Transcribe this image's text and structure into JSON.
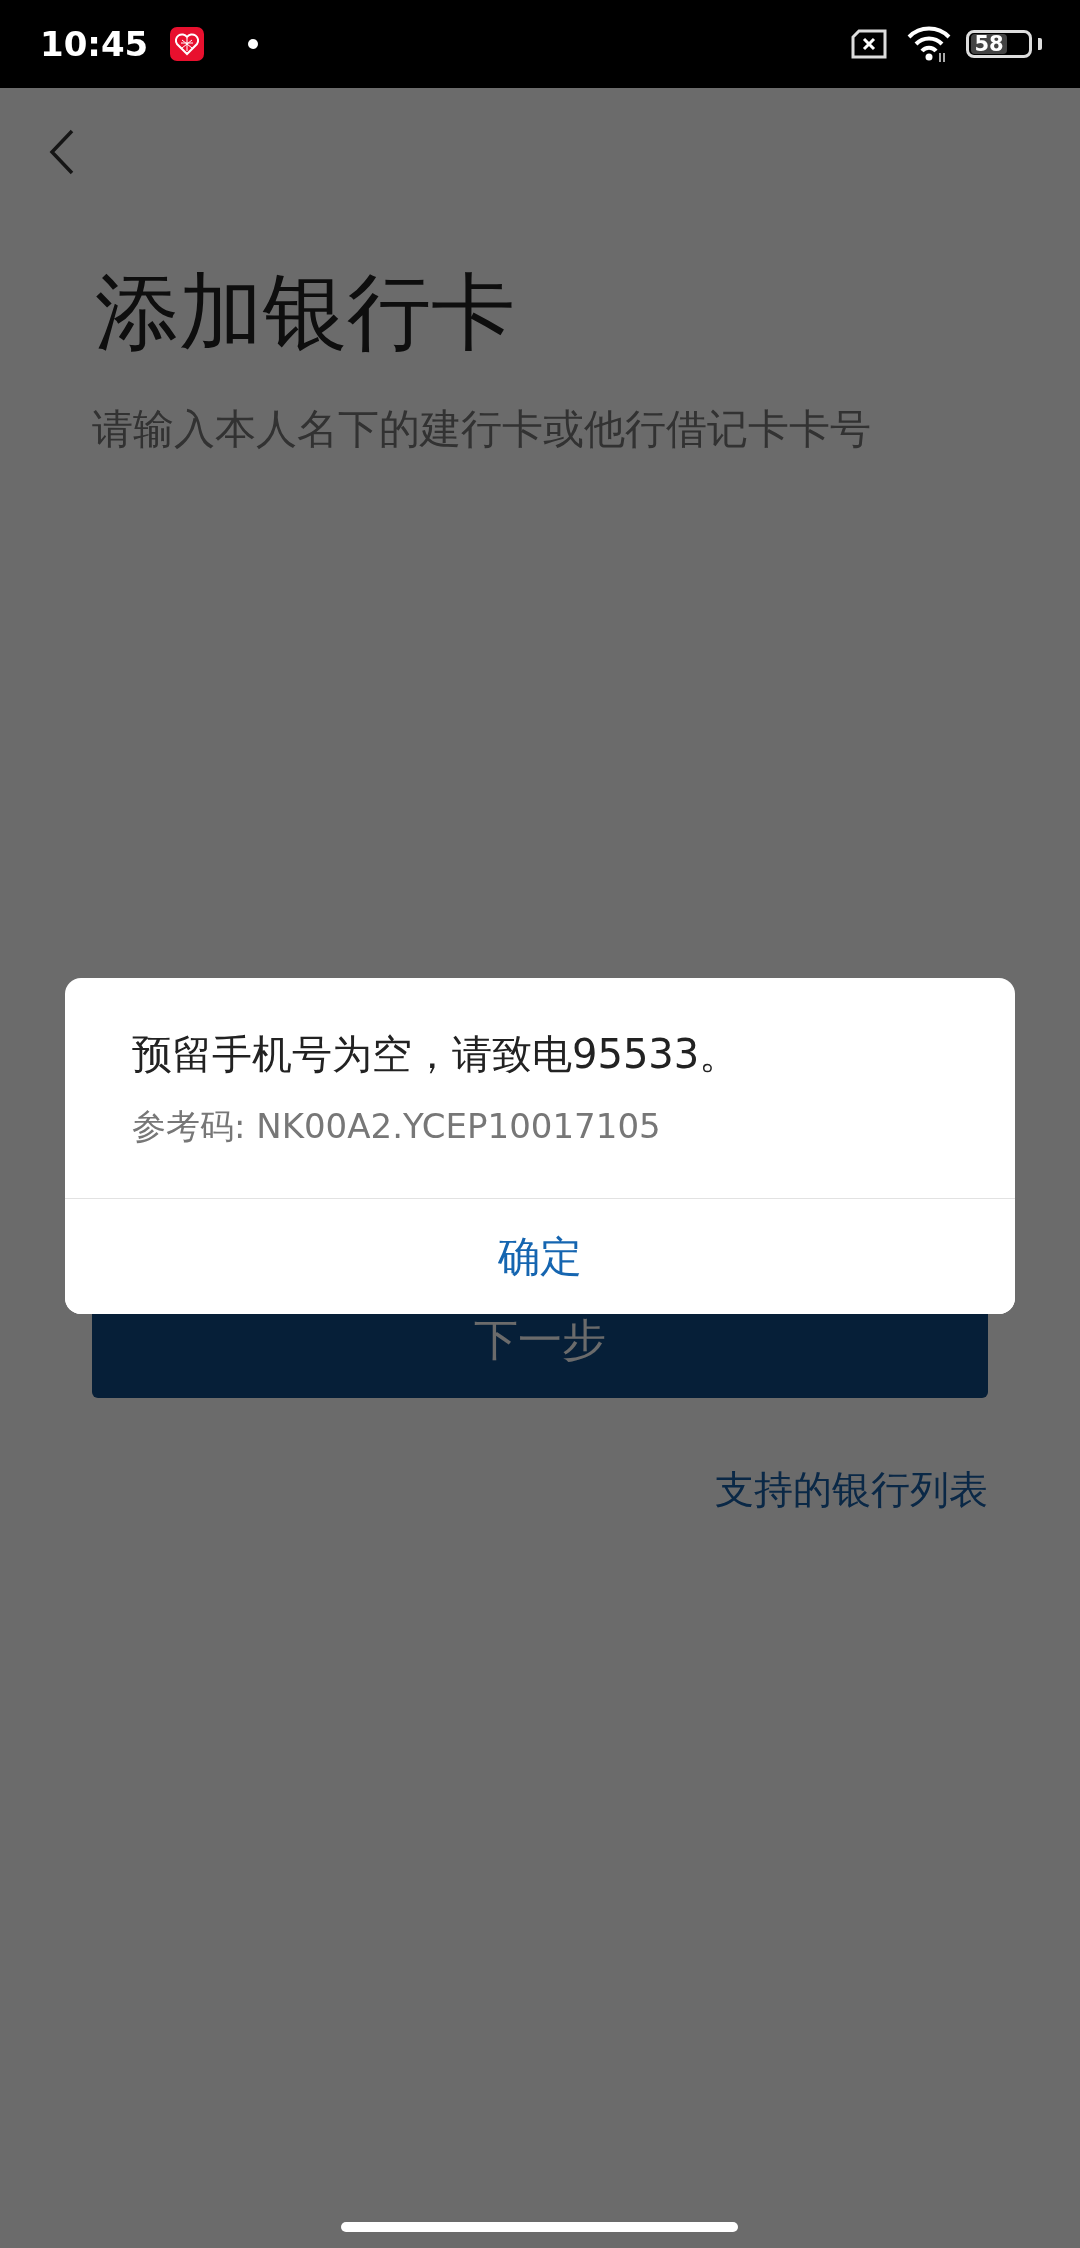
{
  "status_bar": {
    "time": "10:45",
    "battery": "58"
  },
  "page": {
    "title": "添加银行卡",
    "subtitle": "请输入本人名下的建行卡或他行借记卡卡号",
    "next_button": "下一步",
    "bank_list_link": "支持的银行列表"
  },
  "dialog": {
    "message": "预留手机号为空，请致电95533。",
    "reference_code": "参考码: NK00A2.YCEP10017105",
    "confirm_button": "确定"
  }
}
